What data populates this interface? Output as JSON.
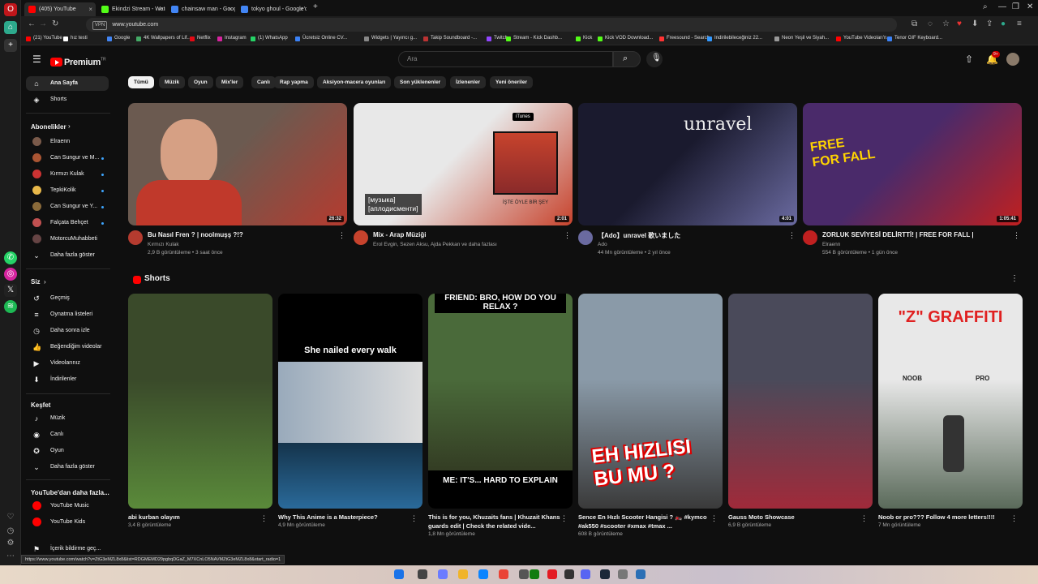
{
  "browser": {
    "tabs": [
      {
        "label": "(405) YouTube",
        "active": true,
        "favicon_color": "#ff0000"
      },
      {
        "label": "Ekindzi Stream - Watch Li",
        "active": false,
        "favicon_color": "#53fc18"
      },
      {
        "label": "chainsaw man - Google'da",
        "active": false,
        "favicon_color": "#4285f4"
      },
      {
        "label": "tokyo ghoul - Google'da a",
        "active": false,
        "favicon_color": "#4285f4"
      }
    ],
    "new_tab": "+",
    "url": "www.youtube.com",
    "vpn": "VPN",
    "bookmarks": [
      {
        "label": "(21) YouTube",
        "color": "#ff0000"
      },
      {
        "label": "hız testi",
        "color": "#ffffff"
      },
      {
        "label": "Google",
        "color": "#4285f4"
      },
      {
        "label": "4K Wallpapers of Lif...",
        "color": "#44aa66"
      },
      {
        "label": "Netflix",
        "color": "#e50914"
      },
      {
        "label": "Instagram",
        "color": "#d6249f"
      },
      {
        "label": "(1) WhatsApp",
        "color": "#25d366"
      },
      {
        "label": "Ücretsiz Online CV...",
        "color": "#3b82f6"
      },
      {
        "label": "Widgets | Yayıncı g...",
        "color": "#888888"
      },
      {
        "label": "Takip Soundboard -...",
        "color": "#bb3333"
      },
      {
        "label": "Twitch",
        "color": "#9146ff"
      },
      {
        "label": "Stream - Kick Dashb...",
        "color": "#53fc18"
      },
      {
        "label": "Kick",
        "color": "#53fc18"
      },
      {
        "label": "Kick VOD Download...",
        "color": "#53fc18"
      },
      {
        "label": "Freesound - Search",
        "color": "#ff3333"
      },
      {
        "label": "Indirilebileceğiniz 22...",
        "color": "#3399ff"
      },
      {
        "label": "Neon Yeşil ve Siyah...",
        "color": "#999999"
      },
      {
        "label": "YouTube Videoları'n...",
        "color": "#ff0000"
      },
      {
        "label": "Tenor GIF Keyboard...",
        "color": "#3b82f6"
      }
    ]
  },
  "youtube": {
    "logo_text": "Premium",
    "logo_sup": "TR",
    "search_placeholder": "Ara",
    "notif_count": "9+",
    "sidebar": {
      "main": [
        {
          "label": "Ana Sayfa",
          "icon": "home-icon",
          "active": true
        },
        {
          "label": "Shorts",
          "icon": "shorts-icon",
          "active": false
        }
      ],
      "subs_header": "Abonelikler",
      "subs": [
        {
          "label": "Elraenn",
          "color": "#7a5a4a"
        },
        {
          "label": "Can Sungur ve M...",
          "color": "#aa5533"
        },
        {
          "label": "Kırmızı Kulak",
          "color": "#cc3333"
        },
        {
          "label": "TepkiKolik",
          "color": "#e8b84a"
        },
        {
          "label": "Can Sungur ve Y...",
          "color": "#8a6a3a"
        },
        {
          "label": "Falçata Behçet",
          "color": "#c05050"
        },
        {
          "label": "MotorcuMuhabbeti",
          "color": "#664444"
        }
      ],
      "subs_more": "Daha fazla göster",
      "you_header": "Siz",
      "you": [
        {
          "label": "Geçmiş",
          "icon": "history-icon"
        },
        {
          "label": "Oynatma listeleri",
          "icon": "playlist-icon"
        },
        {
          "label": "Daha sonra izle",
          "icon": "clock-icon"
        },
        {
          "label": "Beğendiğim videolar",
          "icon": "like-icon"
        },
        {
          "label": "Videolarınız",
          "icon": "video-icon"
        },
        {
          "label": "İndirilenler",
          "icon": "download-icon"
        }
      ],
      "explore_header": "Keşfet",
      "explore": [
        {
          "label": "Müzik",
          "icon": "music-icon"
        },
        {
          "label": "Canlı",
          "icon": "live-icon"
        },
        {
          "label": "Oyun",
          "icon": "gaming-icon"
        }
      ],
      "explore_more": "Daha fazla göster",
      "more_header": "YouTube'dan daha fazla...",
      "more": [
        {
          "label": "YouTube Music"
        },
        {
          "label": "YouTube Kids"
        }
      ],
      "footer_item": "İçerik bildirme geç..."
    },
    "chips": [
      {
        "label": "Tümü",
        "active": true
      },
      {
        "label": "Müzik"
      },
      {
        "label": "Oyun"
      },
      {
        "label": "Mix'ler"
      },
      {
        "label": "Canlı"
      },
      {
        "label": "Rap yapma"
      },
      {
        "label": "Aksiyon-macera oyunları"
      },
      {
        "label": "Son yüklenenler"
      },
      {
        "label": "İzlenenler"
      },
      {
        "label": "Yeni öneriler"
      }
    ],
    "videos": [
      {
        "title": "Bu Nasıl Fren ? | noolmuşş ?!?",
        "channel": "Kırmızı Kulak",
        "stats": "2,9 B görüntüleme • 3 saat önce",
        "duration": "26:32",
        "thumb": "#6b5a50",
        "thumb2": "#b53b2f"
      },
      {
        "title": "Mix - Arap Müziği",
        "channel": "Erol Evgin, Sezen Aksu, Ajda Pekkan ve daha fazlası",
        "stats": "",
        "duration": "2:01",
        "thumb": "#e8e8e8",
        "thumb2": "#c7432d",
        "overlay_ru": "[музыка]\n[аплодисменти]",
        "album_caption": "İŞTE ÖYLE BİR ŞEY",
        "store": "iTunes"
      },
      {
        "title": "【Ado】unravel 歌いました",
        "channel": "Ado",
        "stats": "44 Mn görüntüleme • 2 yıl önce",
        "duration": "4:01",
        "thumb": "#1a1a2e",
        "thumb2": "#6a6aa0",
        "overlay_text": "unravel"
      },
      {
        "title": "ZORLUK SEVİYESİ DELİRTTİ! | FREE FOR FALL |",
        "channel": "Elraenn",
        "stats": "554 B görüntüleme • 1 gün önce",
        "duration": "1:05:41",
        "thumb": "#4a2a6a",
        "thumb2": "#c02020",
        "overlay_text": "FREE FOR FALL"
      }
    ],
    "shorts_header": "Shorts",
    "shorts": [
      {
        "title": "abi kurban olayım",
        "views": "3,4 B görüntüleme",
        "bg": "#3a4a2a",
        "bg2": "#5a8a3a"
      },
      {
        "title": "Why This Anime is a Masterpiece?",
        "views": "4,9 Mn görüntüleme",
        "bg": "#000000",
        "bg2": "#2a6a9a",
        "overlay": "She nailed every walk"
      },
      {
        "title": "This is for you, Khuzaits fans | Khuzait Khans guards edit | Check the related vide...",
        "views": "1,8 Mn görüntüleme",
        "bg": "#4a6a3a",
        "bg2": "#2a2a1a",
        "overlay_top": "FRIEND: BRO, HOW DO YOU RELAX ?",
        "overlay_bottom": "ME: IT'S... HARD TO EXPLAIN"
      },
      {
        "title": "Sence En Hızlı Scooter Hangisi ? 🏍️ #kymco #ak550 #scooter #xmax #tmax ...",
        "views": "608 B görüntüleme",
        "bg": "#8a9aa8",
        "bg2": "#3a3a3a",
        "overlay": "EH HIZLISI BU MU ?"
      },
      {
        "title": "Gauss Moto Showcase",
        "views": "6,9 B görüntüleme",
        "bg": "#4a4a5a",
        "bg2": "#a02a3a"
      },
      {
        "title": "Noob or pro??? Follow 4 more letters!!!!",
        "views": "7 Mn görüntüleme",
        "bg": "#e8e8e8",
        "bg2": "#5a6a5a",
        "overlay_top": "\"Z\" GRAFFITI",
        "label_a": "NOOB",
        "label_b": "PRO"
      }
    ],
    "status_url": "https://www.youtube.com/watch?v=ZtG3eMZL8x8&list=RDGMEMD29pgbqDGaZ_M7XCnLO5NAVMZtG3eMZL8x8&start_radio=1"
  }
}
